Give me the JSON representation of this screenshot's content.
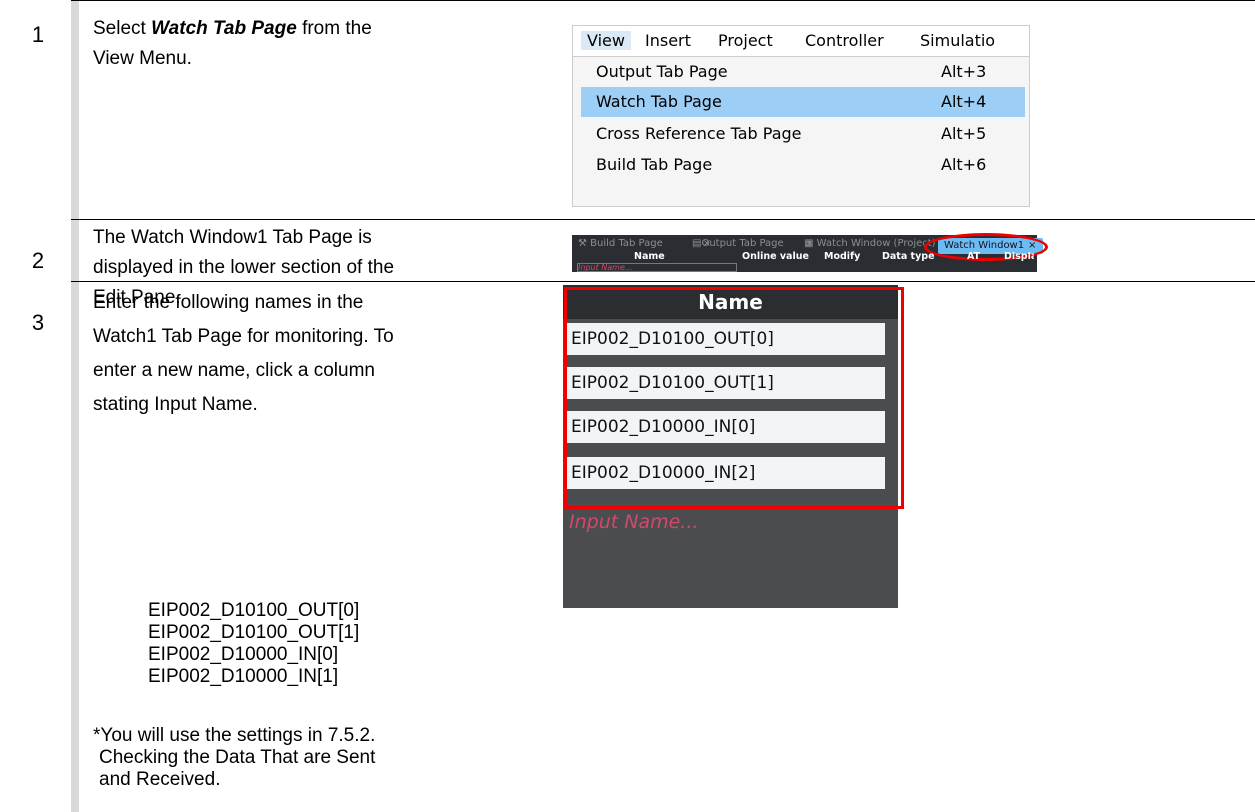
{
  "steps": [
    {
      "num": "1",
      "text_before": "Select ",
      "text_bold": "Watch Tab Page",
      "text_after": " from the",
      "line2": "View Menu."
    },
    {
      "num": "2",
      "lines": [
        "The Watch Window1 Tab Page is",
        "displayed in the lower section of the",
        "Edit Pane."
      ]
    },
    {
      "num": "3",
      "lines": [
        "Enter the following names in the",
        "Watch1 Tab Page for monitoring. To",
        "enter a new name, click a column",
        "stating Input Name."
      ],
      "names": [
        "EIP002_D10100_OUT[0]",
        "EIP002_D10100_OUT[1]",
        "EIP002_D10000_IN[0]",
        "EIP002_D10000_IN[1]"
      ],
      "note": [
        "*You will use the settings in 7.5.2.",
        "Checking the Data That are Sent",
        "and Received."
      ]
    }
  ],
  "menu": {
    "bar": [
      "View",
      "Insert",
      "Project",
      "Controller",
      "Simulatio"
    ],
    "items": [
      {
        "label": "Output Tab Page",
        "shortcut": "Alt+3"
      },
      {
        "label": "Watch Tab Page",
        "shortcut": "Alt+4"
      },
      {
        "label": "Cross Reference Tab Page",
        "shortcut": "Alt+5"
      },
      {
        "label": "Build Tab Page",
        "shortcut": "Alt+6"
      }
    ]
  },
  "tabbar": {
    "tabs": [
      "Build Tab Page",
      "Output Tab Page",
      "Watch Window (Project)",
      "Watch Window1"
    ],
    "close": "×",
    "columns": [
      "Name",
      "Online value",
      "Modify",
      "Data type",
      "AT",
      "Display format"
    ],
    "input_placeholder": "Input Name..."
  },
  "namelist": {
    "header": "Name",
    "rows": [
      "EIP002_D10100_OUT[0]",
      "EIP002_D10100_OUT[1]",
      "EIP002_D10000_IN[0]",
      "EIP002_D10000_IN[2]"
    ],
    "placeholder": "Input Name..."
  }
}
